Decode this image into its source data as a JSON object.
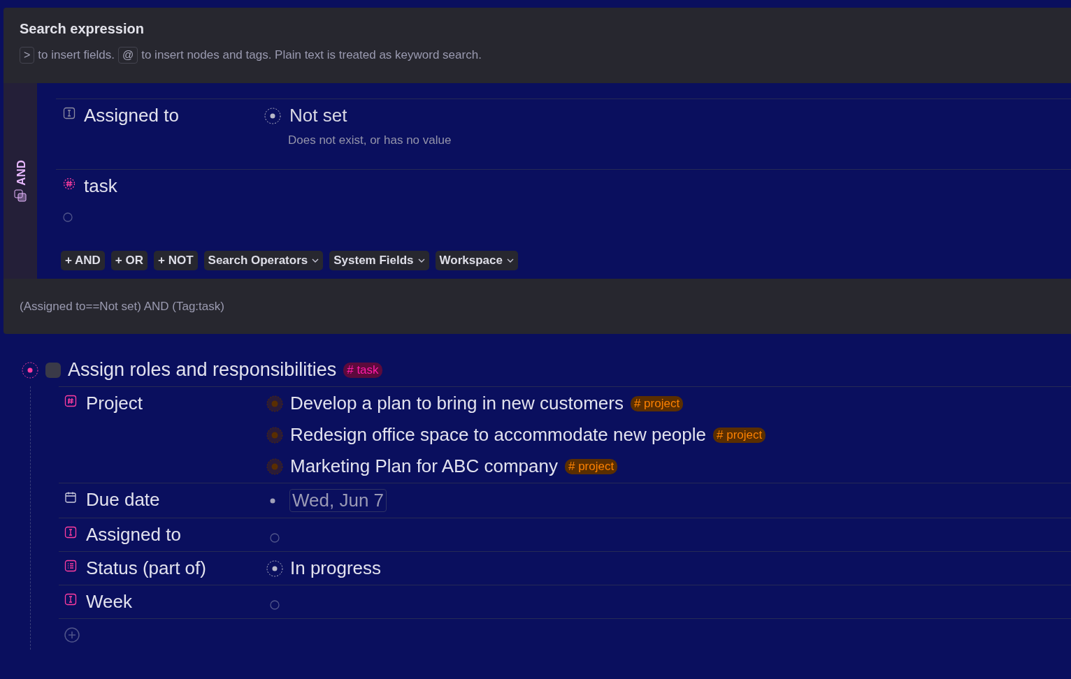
{
  "search_panel": {
    "title": "Search expression",
    "hint": [
      {
        "kind": "key",
        "text": ">"
      },
      {
        "kind": "text",
        "text": "to insert fields."
      },
      {
        "kind": "key",
        "text": "@"
      },
      {
        "kind": "text",
        "text": "to insert nodes and tags. Plain text is treated as keyword search."
      }
    ]
  },
  "query": {
    "operator": "AND",
    "conditions": [
      {
        "kind": "field",
        "label": "Assigned to",
        "value": "Not set",
        "note": "Does not exist, or has no value"
      },
      {
        "kind": "tag",
        "label": "task"
      }
    ],
    "buttons": [
      {
        "kind": "add",
        "label": "+ AND"
      },
      {
        "kind": "add",
        "label": "+ OR"
      },
      {
        "kind": "add",
        "label": "+ NOT"
      },
      {
        "kind": "menu",
        "label": "Search Operators"
      },
      {
        "kind": "menu",
        "label": "System Fields"
      },
      {
        "kind": "menu",
        "label": "Workspace"
      }
    ]
  },
  "expression": "(Assigned to==Not set) AND (Tag:task)",
  "node": {
    "title": "Assign roles and responsibilities",
    "checked": false,
    "tag": {
      "label": "# task",
      "color": "#5c0a3c"
    },
    "fields": [
      {
        "kind": "references",
        "label": "Project",
        "items": [
          {
            "text": "Develop a plan to bring in new customers",
            "tag": {
              "label": "# project",
              "color": "#5a2e00"
            }
          },
          {
            "text": "Redesign office space to accommodate new people",
            "tag": {
              "label": "# project",
              "color": "#5a2e00"
            }
          },
          {
            "text": "Marketing Plan for ABC company",
            "tag": {
              "label": "# project",
              "color": "#5a2e00"
            }
          }
        ]
      },
      {
        "kind": "date",
        "label": "Due date",
        "value": "Wed, Jun 7"
      },
      {
        "kind": "empty",
        "label": "Assigned to"
      },
      {
        "kind": "option",
        "label": "Status (part of)",
        "value": "In progress"
      },
      {
        "kind": "empty",
        "label": "Week"
      }
    ]
  }
}
